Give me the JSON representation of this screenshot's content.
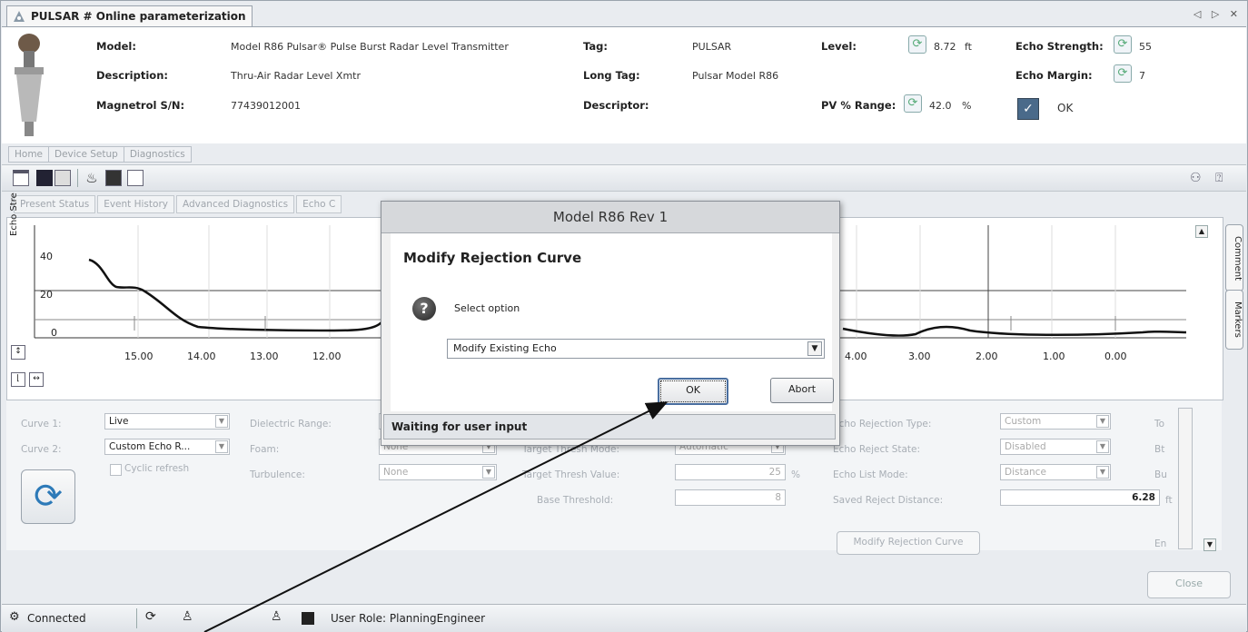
{
  "window": {
    "title": "PULSAR # Online parameterization",
    "controls": "◁ ▷ ✕"
  },
  "device": {
    "model_label": "Model:",
    "model_value": "Model R86 Pulsar® Pulse Burst Radar Level Transmitter",
    "description_label": "Description:",
    "description_value": "Thru-Air Radar Level Xmtr",
    "serial_label": "Magnetrol S/N:",
    "serial_value": "77439012001",
    "tag_label": "Tag:",
    "tag_value": "PULSAR",
    "longtag_label": "Long Tag:",
    "longtag_value": "Pulsar Model R86",
    "descriptor_label": "Descriptor:",
    "descriptor_value": "",
    "level_label": "Level:",
    "level_value": "8.72",
    "level_unit": "ft",
    "pv_label": "PV % Range:",
    "pv_value": "42.0",
    "pv_unit": "%",
    "echo_strength_label": "Echo Strength:",
    "echo_strength_value": "55",
    "echo_margin_label": "Echo Margin:",
    "echo_margin_value": "7",
    "status_ok": "OK"
  },
  "nav_tabs": [
    "Home",
    "Device Setup",
    "Diagnostics"
  ],
  "sub_tabs": [
    "Present Status",
    "Event History",
    "Advanced Diagnostics",
    "Echo C"
  ],
  "chart": {
    "ylabel": "Echo Stre",
    "side_buttons": [
      "Comment",
      "Markers"
    ],
    "yticks": [
      "40",
      "20",
      "0"
    ],
    "xticks": [
      "15.00",
      "14.00",
      "13.00",
      "12.00",
      "4.00",
      "3.00",
      "2.00",
      "1.00",
      "0.00"
    ]
  },
  "form": {
    "curve1_label": "Curve 1:",
    "curve1_value": "Live",
    "curve2_label": "Curve 2:",
    "curve2_value": "Custom Echo R...",
    "cyclic_label": "Cyclic refresh",
    "dielectric_label": "Dielectric Range:",
    "foam_label": "Foam:",
    "foam_value": "None",
    "turbulence_label": "Turbulence:",
    "turbulence_value": "None",
    "thresh_mode_label": "Target Thresh Mode:",
    "thresh_mode_value": "Automatic",
    "thresh_value_label": "Target Thresh Value:",
    "thresh_value": "25",
    "thresh_unit": "%",
    "base_thresh_label": "Base Threshold:",
    "base_thresh_value": "8",
    "rej_type_label": "Echo Rejection Type:",
    "rej_type_value": "Custom",
    "rej_state_label": "Echo Reject State:",
    "rej_state_value": "Disabled",
    "list_mode_label": "Echo List Mode:",
    "list_mode_value": "Distance",
    "saved_dist_label": "Saved Reject Distance:",
    "saved_dist_value": "6.28",
    "saved_dist_unit": "ft",
    "modify_btn": "Modify Rejection Curve",
    "cut_labels": [
      "To",
      "Bt",
      "Bu",
      "En"
    ]
  },
  "close_label": "Close",
  "statusbar": {
    "connected": "Connected",
    "role": "User Role: PlanningEngineer"
  },
  "dialog": {
    "title": "Model R86 Rev 1",
    "heading": "Modify Rejection Curve",
    "prompt": "Select option",
    "selected": "Modify Existing Echo",
    "ok": "OK",
    "abort": "Abort",
    "status": "Waiting for user input"
  }
}
